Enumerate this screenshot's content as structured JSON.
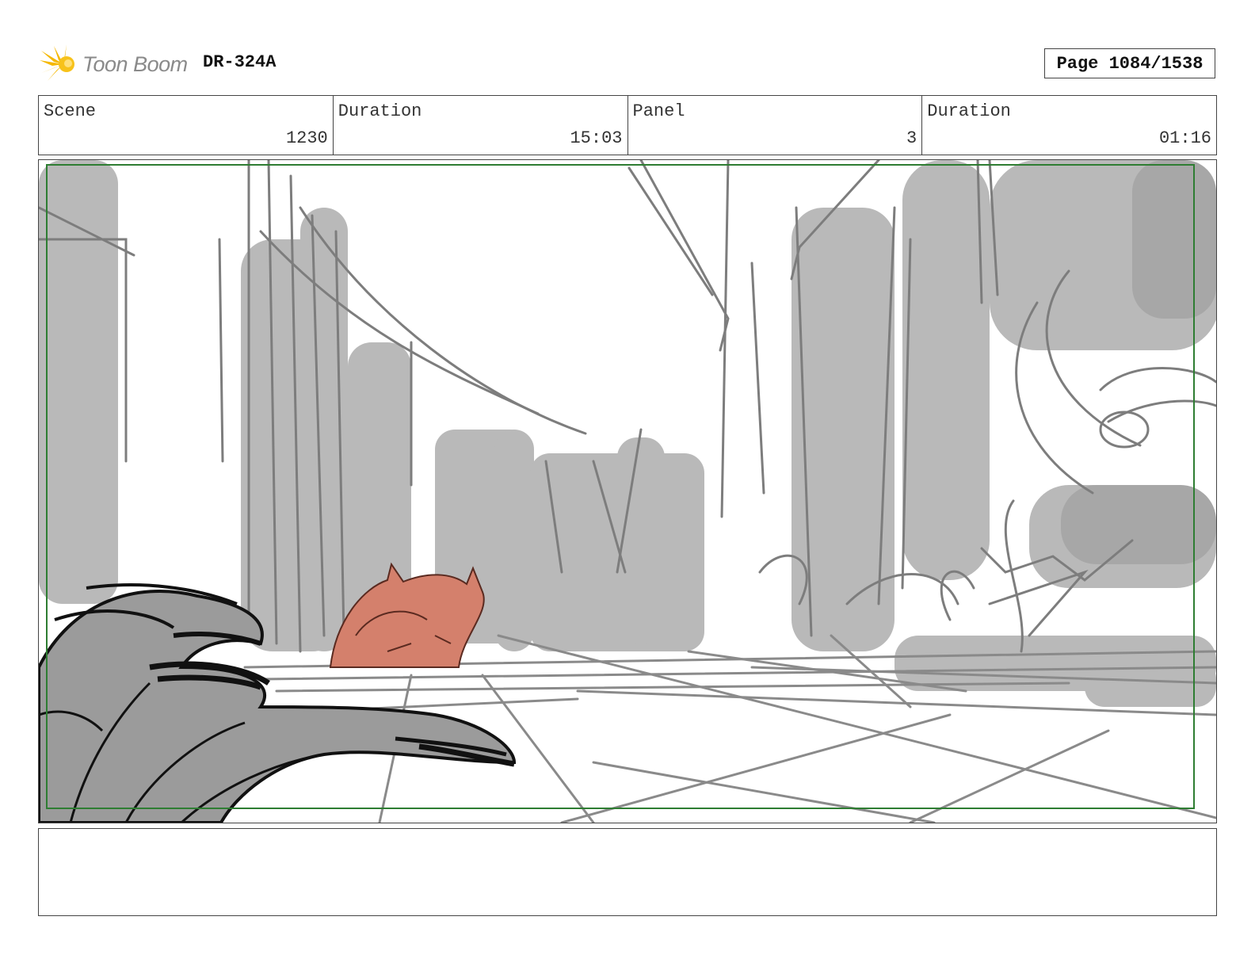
{
  "header": {
    "logo_text": "Toon Boom",
    "doc_id": "DR-324A",
    "page_label": "Page 1084/1538"
  },
  "info": {
    "scene_label": "Scene",
    "scene_value": "1230",
    "scene_duration_label": "Duration",
    "scene_duration_value": "15:03",
    "panel_label": "Panel",
    "panel_value": "3",
    "panel_duration_label": "Duration",
    "panel_duration_value": "01:16"
  },
  "notes": {
    "text": ""
  },
  "colors": {
    "safe_frame": "#2e7d32",
    "character_fill": "#d4806c",
    "sketch_gray": "#7a7a7a",
    "fill_gray": "#b4b4b4"
  }
}
